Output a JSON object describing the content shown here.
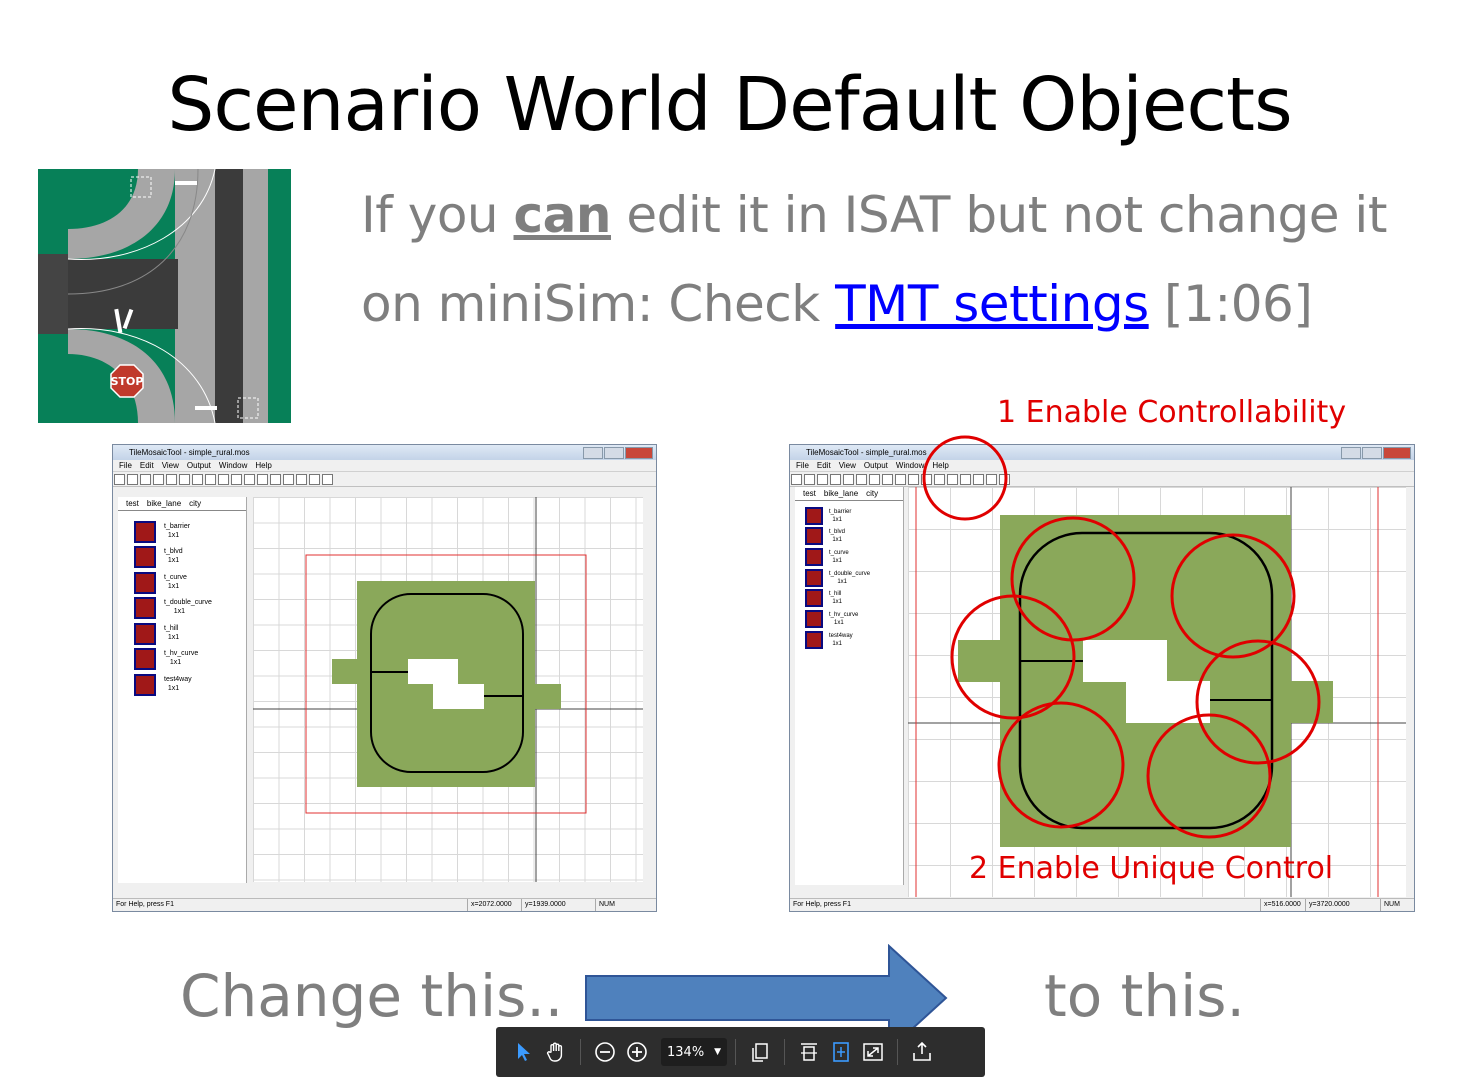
{
  "slide": {
    "title": "Scenario World Default Objects",
    "line1": {
      "before": "If you ",
      "emphasis": "can",
      "after": " edit it in ISAT but not change it"
    },
    "line2": {
      "before": "on miniSim: Check ",
      "link": "TMT settings",
      "after": " [1:06]"
    },
    "stop_sign": "STOP",
    "annotation_1": "1 Enable Controllability",
    "annotation_2": "2 Enable Unique Control",
    "change_text": "Change this..",
    "to_text": "to this."
  },
  "left_window": {
    "title": "TileMosaicTool - simple_rural.mos",
    "menu": [
      "File",
      "Edit",
      "View",
      "Output",
      "Window",
      "Help"
    ],
    "tabs": [
      "test",
      "bike_lane",
      "city"
    ],
    "tiles": [
      {
        "name": "t_barrier",
        "size": "1x1"
      },
      {
        "name": "t_blvd",
        "size": "1x1"
      },
      {
        "name": "t_curve",
        "size": "1x1"
      },
      {
        "name": "t_double_curve",
        "size": "1x1"
      },
      {
        "name": "t_hill",
        "size": "1x1"
      },
      {
        "name": "t_hv_curve",
        "size": "1x1"
      },
      {
        "name": "test4way",
        "size": "1x1"
      }
    ],
    "status": {
      "help": "For Help, press F1",
      "x": "x=2072.0000",
      "y": "y=1939.0000",
      "num": "NUM"
    }
  },
  "right_window": {
    "title": "TileMosaicTool - simple_rural.mos",
    "menu": [
      "File",
      "Edit",
      "View",
      "Output",
      "Window",
      "Help"
    ],
    "tabs": [
      "test",
      "bike_lane",
      "city"
    ],
    "tiles": [
      {
        "name": "t_barrier",
        "size": "1x1"
      },
      {
        "name": "t_blvd",
        "size": "1x1"
      },
      {
        "name": "t_curve",
        "size": "1x1"
      },
      {
        "name": "t_double_curve",
        "size": "1x1"
      },
      {
        "name": "t_hill",
        "size": "1x1"
      },
      {
        "name": "t_hv_curve",
        "size": "1x1"
      },
      {
        "name": "test4way",
        "size": "1x1"
      }
    ],
    "status": {
      "help": "For Help, press F1",
      "x": "x=516.0000",
      "y": "y=3720.0000",
      "num": "NUM"
    }
  },
  "viewer_toolbar": {
    "zoom": "134%",
    "icons": [
      "select-icon",
      "hand-icon",
      "zoom-out-icon",
      "zoom-in-icon",
      "page-copy-icon",
      "fit-width-icon",
      "fit-page-icon",
      "fullscreen-icon",
      "share-icon"
    ]
  },
  "colors": {
    "title_text": "#000000",
    "body_text": "#7f7f7f",
    "link": "#0000ff",
    "annotation": "#e00000",
    "arrow": "#4f81bd",
    "grass": "#8aa85a",
    "toolbar_bg": "#2d2d2d",
    "accent_icon": "#3b9bff"
  }
}
